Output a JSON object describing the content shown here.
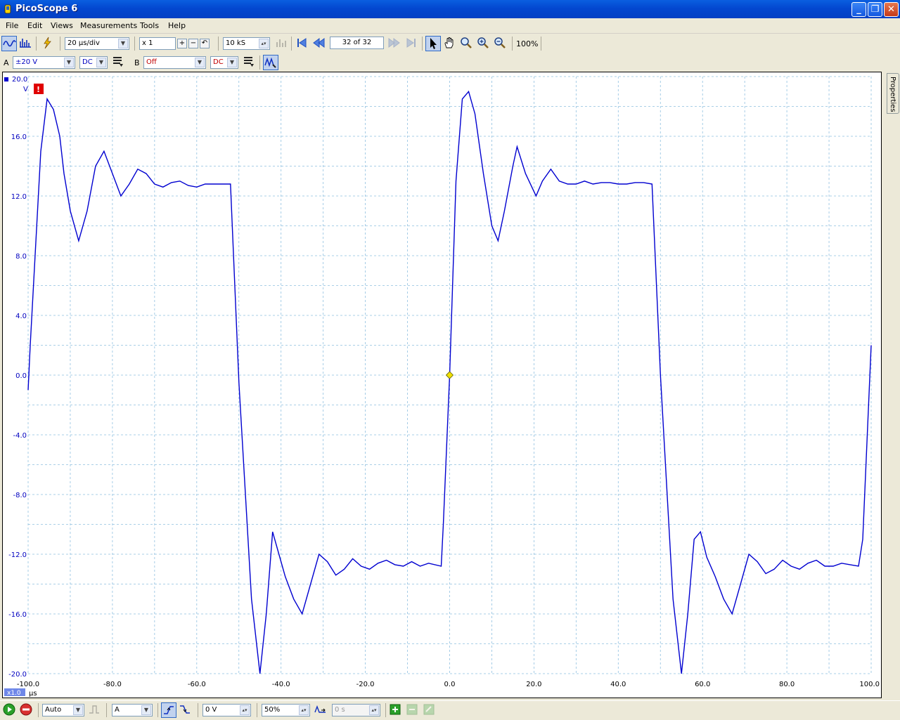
{
  "window": {
    "title": "PicoScope 6"
  },
  "menu": [
    "File",
    "Edit",
    "Views",
    "Measurements",
    "Tools",
    "Help"
  ],
  "toolbar": {
    "timebase": "20 µs/div",
    "zoom_factor": "x 1",
    "samples": "10 kS",
    "buffer_position": "32 of 32",
    "zoom_percent": "100%"
  },
  "channels": {
    "a": {
      "label": "A",
      "range": "±20 V",
      "coupling": "DC"
    },
    "b": {
      "label": "B",
      "range": "Off",
      "coupling": "DC"
    }
  },
  "scope": {
    "y_unit": "V",
    "x_unit": "µs",
    "x_scale_badge": "x1.0",
    "y_top_label": "20.0",
    "y_ticks": [
      "16.0",
      "12.0",
      "8.0",
      "4.0",
      "0.0",
      "-4.0",
      "-8.0",
      "-12.0",
      "-16.0",
      "-20.0"
    ],
    "x_ticks": [
      "-100.0",
      "-80.0",
      "-60.0",
      "-40.0",
      "-20.0",
      "0.0",
      "20.0",
      "40.0",
      "60.0",
      "80.0",
      "100.0"
    ],
    "trace_color": "#0000d0",
    "grid_color": "#8fc0e0",
    "trigger_marker_color": "#f0e000",
    "warning_color": "#e00000"
  },
  "chart_data": {
    "type": "line",
    "xlabel": "µs",
    "ylabel": "V",
    "xlim": [
      -100,
      100
    ],
    "ylim": [
      -20,
      20
    ],
    "grid": true,
    "series": [
      {
        "x": [
          -100,
          -99.5,
          -97,
          -95.5,
          -94,
          -92.5,
          -91.5,
          -90,
          -88,
          -86,
          -84,
          -82,
          -80,
          -78,
          -76,
          -74,
          -72,
          -70,
          -68,
          -66,
          -64,
          -62,
          -60,
          -58,
          -52,
          -50,
          -47,
          -45,
          -43.5,
          -42,
          -40.5,
          -39,
          -37,
          -35,
          -33,
          -31,
          -29,
          -27,
          -25,
          -23,
          -21,
          -19,
          -17,
          -15,
          -13,
          -11,
          -9,
          -7,
          -5,
          -2,
          -1.5,
          0,
          1.5,
          3,
          4.5,
          6,
          8,
          10,
          11.5,
          13,
          15,
          16,
          18,
          20.5,
          22,
          24,
          26,
          28,
          30,
          32,
          34,
          36,
          38,
          40,
          42,
          44,
          46,
          48,
          50,
          53,
          55,
          56.5,
          58,
          59.5,
          61,
          63,
          65,
          67,
          69,
          71,
          73,
          75,
          77,
          79,
          81,
          83,
          85,
          87,
          89,
          91,
          93,
          95,
          97,
          98,
          100
        ],
        "y": [
          -1,
          2,
          15,
          18.5,
          17.8,
          16,
          13.5,
          11,
          9,
          11,
          14,
          15,
          13.5,
          12,
          12.8,
          13.8,
          13.5,
          12.8,
          12.6,
          12.9,
          13,
          12.7,
          12.6,
          12.8,
          12.8,
          -0.5,
          -15,
          -20,
          -16,
          -10.5,
          -12,
          -13.5,
          -15,
          -16,
          -14,
          -12,
          -12.5,
          -13.4,
          -13,
          -12.3,
          -12.8,
          -13,
          -12.6,
          -12.4,
          -12.7,
          -12.8,
          -12.5,
          -12.8,
          -12.6,
          -12.8,
          -10,
          0,
          13,
          18.5,
          19,
          17.5,
          13.5,
          10,
          9,
          11,
          14,
          15.3,
          13.5,
          12,
          13,
          13.8,
          13,
          12.8,
          12.8,
          13,
          12.8,
          12.9,
          12.9,
          12.8,
          12.8,
          12.9,
          12.9,
          12.8,
          0,
          -15,
          -20,
          -16,
          -11,
          -10.5,
          -12.2,
          -13.5,
          -15,
          -16,
          -14,
          -12,
          -12.5,
          -13.3,
          -13,
          -12.4,
          -12.8,
          -13,
          -12.6,
          -12.4,
          -12.8,
          -12.8,
          -12.6,
          -12.7,
          -12.8,
          -11,
          2
        ]
      }
    ]
  }
}
